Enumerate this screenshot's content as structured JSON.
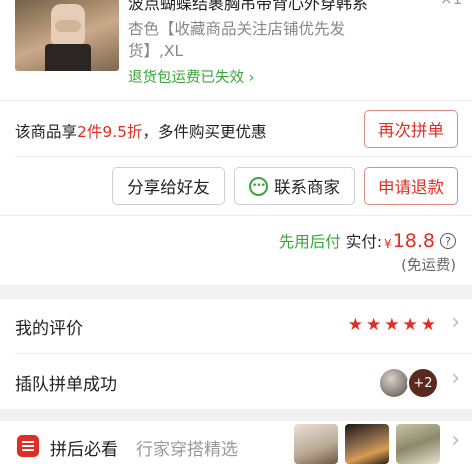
{
  "product": {
    "title": "波点蝴蝶结裹胸吊带背心外穿韩系",
    "quantity": "×1",
    "spec": "杏色【收藏商品关注店铺优先发货】,XL",
    "return_tip": "退货包运费已失效",
    "return_tip_color": "#3aa53a"
  },
  "discount": {
    "prefix": "该商品享",
    "highlight": "2件9.5折",
    "suffix": "，多件购买更优惠",
    "rebuy_button": "再次拼单"
  },
  "actions": {
    "share": "分享给好友",
    "contact": "联系商家",
    "refund": "申请退款"
  },
  "payment": {
    "tag": "先用后付",
    "label": "实付:",
    "currency": "¥",
    "amount": "18.8",
    "shipping": "(免运费)"
  },
  "review": {
    "label": "我的评价",
    "stars": 5
  },
  "group": {
    "label": "插队拼单成功",
    "extra_count": "+2"
  },
  "recommend": {
    "title": "拼后必看",
    "subtitle": "行家穿搭精选"
  },
  "colors": {
    "accent_red": "#e02e24",
    "success_green": "#3aa53a"
  }
}
